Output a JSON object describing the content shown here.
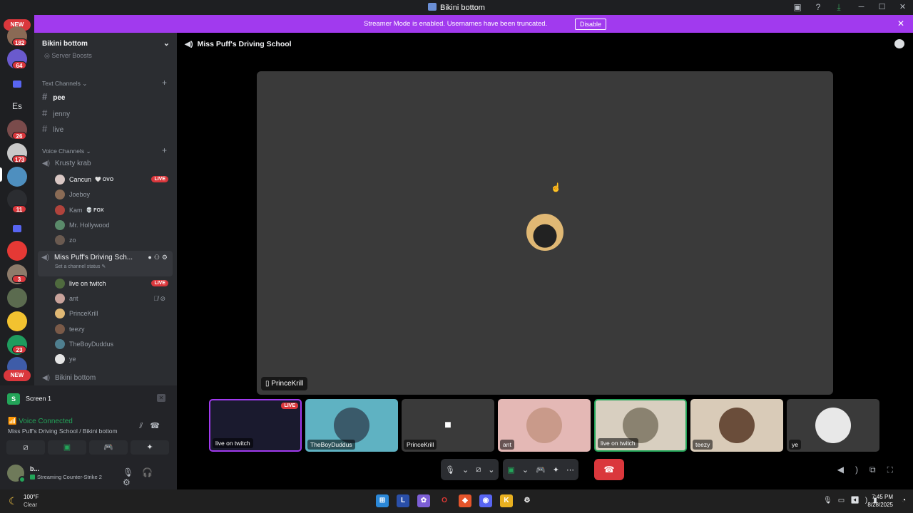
{
  "window": {
    "title": "Bikini bottom"
  },
  "banner": {
    "message": "Streamer Mode is enabled. Usernames have been truncated.",
    "button": "Disable"
  },
  "servers": {
    "new_label": "NEW",
    "badges": [
      "182",
      "64",
      "26",
      "173",
      "11",
      "3",
      "23"
    ],
    "text_server": "Es"
  },
  "sidebar": {
    "server_name": "Bikini bottom",
    "boosts": "Server Boosts",
    "text_category": "Text Channels",
    "text_channels": [
      "pee",
      "jenny",
      "live"
    ],
    "voice_category": "Voice Channels",
    "voice_channels": {
      "krusty": "Krusty krab",
      "krusty_users": [
        {
          "name": "Cancun",
          "tag": "🤍 OVO",
          "live": "LIVE"
        },
        {
          "name": "Joeboy"
        },
        {
          "name": "Kam",
          "tag": "💀 FOX"
        },
        {
          "name": "Mr. Hollywood"
        },
        {
          "name": "zo"
        }
      ],
      "current": "Miss Puff's Driving Sch...",
      "current_status": "Set a channel status",
      "current_users": [
        {
          "name": "live on twitch",
          "live": "LIVE"
        },
        {
          "name": "ant"
        },
        {
          "name": "PrinceKrill"
        },
        {
          "name": "teezy"
        },
        {
          "name": "TheBoyDuddus"
        },
        {
          "name": "ye"
        }
      ],
      "bikini": "Bikini bottom"
    }
  },
  "panel": {
    "screen": "Screen 1",
    "voice_connected": "Voice Connected",
    "voice_sub": "Miss Puff's Driving School / Bikini bottom",
    "user_name": "b...",
    "user_status": "Streaming Counter-Strike 2"
  },
  "stage": {
    "channel_title": "Miss Puff's Driving School",
    "main_label": "PrinceKrill",
    "tiles": [
      {
        "label": "live on twitch",
        "live": "LIVE"
      },
      {
        "label": "TheBoyDuddus"
      },
      {
        "label": "PrinceKrill"
      },
      {
        "label": "ant"
      },
      {
        "label": "live on twitch"
      },
      {
        "label": "teezy"
      },
      {
        "label": "ye"
      }
    ]
  },
  "taskbar": {
    "temp": "100°F",
    "condition": "Clear",
    "time": "7:45 PM",
    "date": "8/28/2025"
  },
  "colors": {
    "accent": "#a13aee",
    "danger": "#da373c",
    "green": "#23a559",
    "blurple": "#5865f2"
  }
}
